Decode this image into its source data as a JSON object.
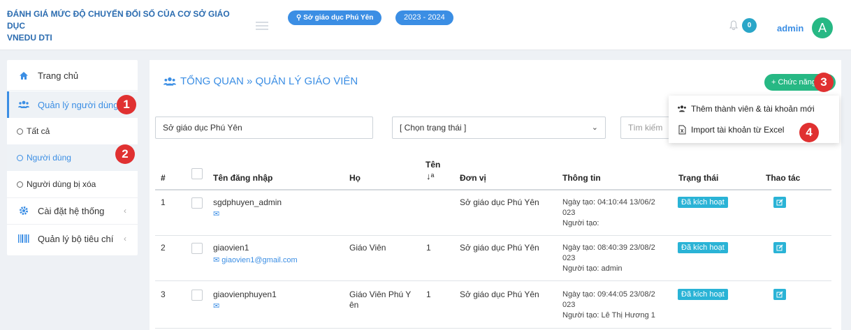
{
  "header": {
    "brand_line1": "ĐÁNH GIÁ MỨC ĐỘ CHUYỂN ĐỔI SỐ CỦA CƠ SỞ GIÁO DỤC",
    "brand_line2": "VNEDU DTI",
    "unit_pill": "Sở giáo dục Phú Yên",
    "year_pill": "2023 - 2024",
    "notification_count": "0",
    "username": "admin",
    "avatar_letter": "A"
  },
  "sidebar": {
    "items": [
      {
        "label": "Trang chủ",
        "icon": "home-icon"
      },
      {
        "label": "Quản lý người dùng",
        "icon": "users-icon"
      },
      {
        "label": "Tất cả"
      },
      {
        "label": "Người dùng"
      },
      {
        "label": "Người dùng bị xóa"
      },
      {
        "label": "Cài đặt hệ thống",
        "icon": "gear-icon"
      },
      {
        "label": "Quản lý bộ tiêu chí",
        "icon": "barcode-icon"
      }
    ],
    "chevron": "‹"
  },
  "markers": [
    "1",
    "2",
    "3",
    "4"
  ],
  "main": {
    "title": "TỔNG QUAN » QUẢN LÝ GIÁO VIÊN",
    "function_button": "+ Chức năng",
    "dropdown": [
      "Thêm thành viên & tài khoản mới",
      "Import tài khoản từ Excel"
    ],
    "filters": {
      "unit_value": "Sở giáo dục Phú Yên",
      "status_value": "[ Chọn trạng thái ]",
      "search_placeholder": "Tìm kiếm"
    }
  },
  "table": {
    "headers": {
      "num": "#",
      "username": "Tên đăng nhập",
      "last": "Họ",
      "first_line1": "Tên",
      "unit": "Đơn vị",
      "info": "Thông tin",
      "status": "Trạng thái",
      "actions": "Thao tác"
    },
    "rows": [
      {
        "num": "1",
        "username": "sgdphuyen_admin",
        "email": "",
        "last": "",
        "first": "",
        "unit": "Sở giáo dục Phú Yên",
        "created": "Ngày tạo: 04:10:44 13/06/2",
        "created2": "023",
        "creator": "Người tạo:",
        "status": "Đã kích hoạt"
      },
      {
        "num": "2",
        "username": "giaovien1",
        "email": "giaovien1@gmail.com",
        "last": "Giáo Viên",
        "first": "1",
        "unit": "Sở giáo dục Phú Yên",
        "created": "Ngày tạo: 08:40:39 23/08/2",
        "created2": "023",
        "creator": "Người tạo: admin",
        "status": "Đã kích hoạt"
      },
      {
        "num": "3",
        "username": "giaovienphuyen1",
        "email": "",
        "last": "Giáo Viên Phú Y",
        "last2": "ên",
        "first": "1",
        "unit": "Sở giáo dục Phú Yên",
        "created": "Ngày tạo: 09:44:05 23/08/2",
        "created2": "023",
        "creator": "Người tạo: Lê Thị Hương 1",
        "status": "Đã kích hoạt"
      }
    ]
  },
  "colors": {
    "accent": "#3b8ee4",
    "success": "#27b884",
    "info": "#2ab3d6",
    "marker": "#e03131"
  }
}
